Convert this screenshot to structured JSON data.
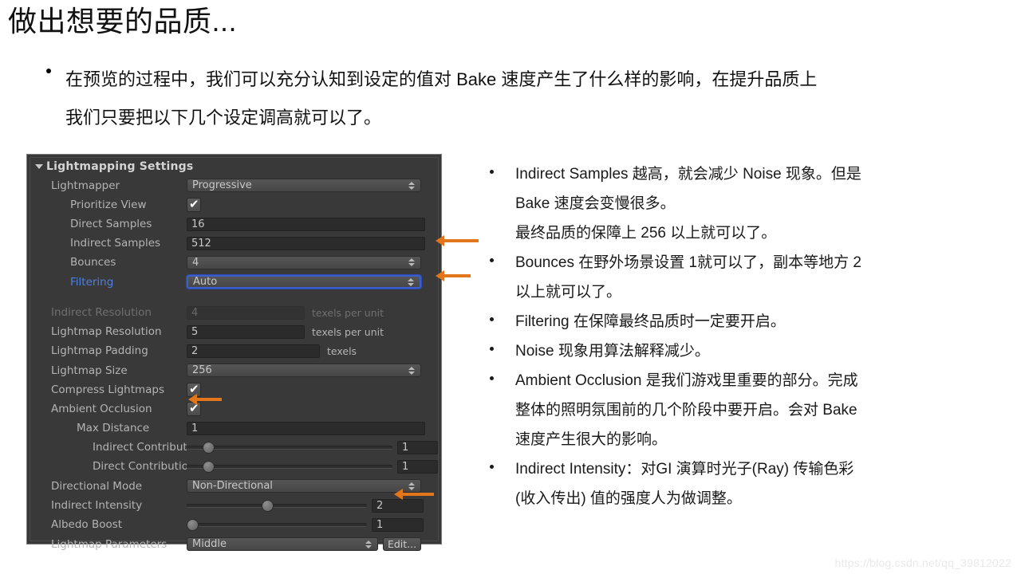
{
  "slide": {
    "title": "做出想要的品质...",
    "intro_bullet": {
      "line1": "在预览的过程中，我们可以充分认知到设定的值对 Bake 速度产生了什么样的影响，在提升品质上",
      "line2": "我们只要把以下几个设定调高就可以了。"
    },
    "watermark": "https://blog.csdn.net/qq_39812022"
  },
  "notes": [
    {
      "line": "Indirect Samples 越高，就会减少 Noise 现象。但是",
      "cont1": "Bake 速度会变慢很多。",
      "cont2": "最终品质的保障上 256 以上就可以了。"
    },
    {
      "line": "Bounces 在野外场景设置 1就可以了，副本等地方 2",
      "cont1": "以上就可以了。"
    },
    {
      "line": "Filtering 在保障最终品质时一定要开启。"
    },
    {
      "line": "Noise 现象用算法解释减少。"
    },
    {
      "line": "Ambient Occlusion 是我们游戏里重要的部分。完成",
      "cont1": "整体的照明氛围前的几个阶段中要开启。会对 Bake",
      "cont2": "速度产生很大的影响。"
    },
    {
      "line": "Indirect Intensity：对GI 演算时光子(Ray) 传输色彩",
      "cont1": "(收入传出) 值的强度人为做调整。"
    }
  ],
  "inspector": {
    "header": "Lightmapping Settings",
    "accent_color": "#4f7fe0",
    "annotation_color": "#e2761b",
    "rows": {
      "lightmapper": {
        "label": "Lightmapper",
        "value": "Progressive"
      },
      "prioritize_view": {
        "label": "Prioritize View",
        "value": "checked"
      },
      "direct_samples": {
        "label": "Direct Samples",
        "value": "16"
      },
      "indirect_samples": {
        "label": "Indirect Samples",
        "value": "512"
      },
      "bounces": {
        "label": "Bounces",
        "value": "4"
      },
      "filtering": {
        "label": "Filtering",
        "value": "Auto"
      },
      "indirect_resolution": {
        "label": "Indirect Resolution",
        "value": "4",
        "unit": "texels per unit"
      },
      "lightmap_resolution": {
        "label": "Lightmap Resolution",
        "value": "5",
        "unit": "texels per unit"
      },
      "lightmap_padding": {
        "label": "Lightmap Padding",
        "value": "2",
        "unit": "texels"
      },
      "lightmap_size": {
        "label": "Lightmap Size",
        "value": "256"
      },
      "compress_lightmaps": {
        "label": "Compress Lightmaps",
        "value": "checked"
      },
      "ambient_occlusion": {
        "label": "Ambient Occlusion",
        "value": "checked"
      },
      "max_distance": {
        "label": "Max Distance",
        "value": "1"
      },
      "indirect_contribution": {
        "label": "Indirect Contributi",
        "value": "1"
      },
      "direct_contribution": {
        "label": "Direct Contribution",
        "value": "1"
      },
      "directional_mode": {
        "label": "Directional Mode",
        "value": "Non-Directional"
      },
      "indirect_intensity": {
        "label": "Indirect Intensity",
        "value": "2"
      },
      "albedo_boost": {
        "label": "Albedo Boost",
        "value": "1"
      },
      "lightmap_parameters": {
        "label": "Lightmap Parameters",
        "value": "Middle",
        "edit_label": "Edit..."
      }
    }
  }
}
